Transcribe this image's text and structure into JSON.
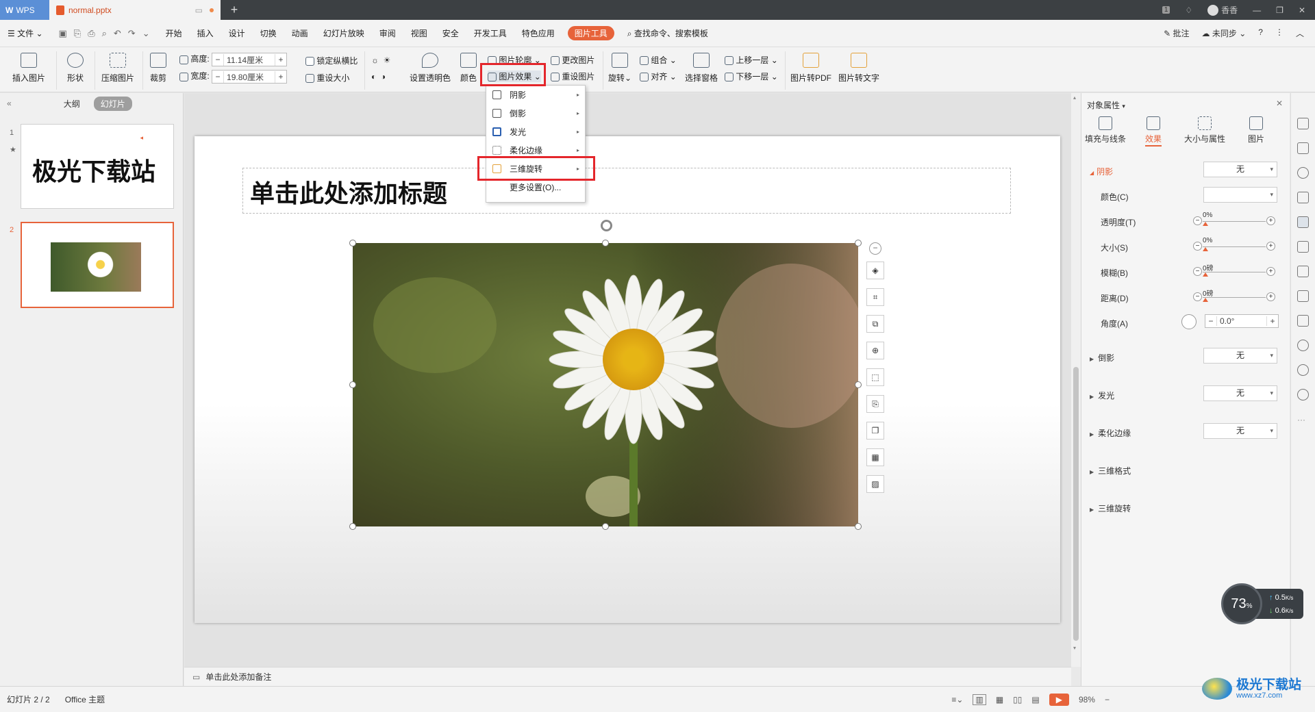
{
  "titlebar": {
    "app_tab": "WPS",
    "file_tab": "normal.pptx",
    "new_tab_symbol": "+",
    "badge": "1",
    "user": "香香"
  },
  "menubar": {
    "file": "文件",
    "items": [
      "开始",
      "插入",
      "设计",
      "切换",
      "动画",
      "幻灯片放映",
      "审阅",
      "视图",
      "安全",
      "开发工具",
      "特色应用"
    ],
    "active_tab": "图片工具",
    "search": "查找命令、搜索模板",
    "comment": "批注",
    "sync": "未同步",
    "help": "?"
  },
  "ribbon": {
    "insert_picture": "插入图片",
    "shape": "形状",
    "compress": "压缩图片",
    "crop": "裁剪",
    "height_label": "高度:",
    "height_value": "11.14厘米",
    "width_label": "宽度:",
    "width_value": "19.80厘米",
    "lock_ratio": "锁定纵横比",
    "reset_size": "重设大小",
    "set_transparent": "设置透明色",
    "color": "颜色",
    "picture_outline": "图片轮廓",
    "picture_effect": "图片效果",
    "change_picture": "更改图片",
    "reset_picture": "重设图片",
    "rotate": "旋转",
    "group": "组合",
    "align": "对齐",
    "selection_pane": "选择窗格",
    "bring_forward": "上移一层",
    "send_backward": "下移一层",
    "to_pdf": "图片转PDF",
    "to_text": "图片转文字"
  },
  "dropdown": {
    "items": [
      {
        "label": "阴影",
        "arrow": true
      },
      {
        "label": "倒影",
        "arrow": true
      },
      {
        "label": "发光",
        "arrow": true
      },
      {
        "label": "柔化边缘",
        "arrow": true
      },
      {
        "label": "三维旋转",
        "arrow": true
      },
      {
        "label": "更多设置(O)...",
        "arrow": false
      }
    ]
  },
  "left_panel": {
    "tab_outline": "大纲",
    "tab_slides": "幻灯片",
    "slide1_num": "1",
    "slide1_text": "极光下载站",
    "slide2_num": "2"
  },
  "slide": {
    "title_placeholder": "单击此处添加标题"
  },
  "notes": {
    "placeholder": "单击此处添加备注"
  },
  "right_panel": {
    "header": "对象属性",
    "tabs": [
      "填充与线条",
      "效果",
      "大小与属性",
      "图片"
    ],
    "active_tab": "效果",
    "shadow": {
      "label": "阴影",
      "value": "无"
    },
    "rows": [
      {
        "label": "颜色(C)"
      },
      {
        "label": "透明度(T)",
        "value": "0%"
      },
      {
        "label": "大小(S)",
        "value": "0%"
      },
      {
        "label": "模糊(B)",
        "value": "0磅"
      },
      {
        "label": "距离(D)",
        "value": "0磅"
      }
    ],
    "angle": {
      "label": "角度(A)",
      "value": "0.0°"
    },
    "reflection": {
      "label": "倒影",
      "value": "无"
    },
    "glow": {
      "label": "发光",
      "value": "无"
    },
    "soft_edges": {
      "label": "柔化边缘",
      "value": "无"
    },
    "format_3d": "三维格式",
    "rotation_3d": "三维旋转"
  },
  "status": {
    "slide_info": "幻灯片 2 / 2",
    "theme": "Office 主题",
    "zoom": "98%"
  },
  "net_widget": {
    "percent": "73",
    "percent_sign": "%",
    "up": "0.5",
    "down": "0.6",
    "unit": "K/s"
  },
  "watermark": {
    "title": "极光下载站",
    "site": "www.xz7.com"
  },
  "colors": {
    "accent": "#e7633a",
    "highlight": "#e4262b"
  }
}
